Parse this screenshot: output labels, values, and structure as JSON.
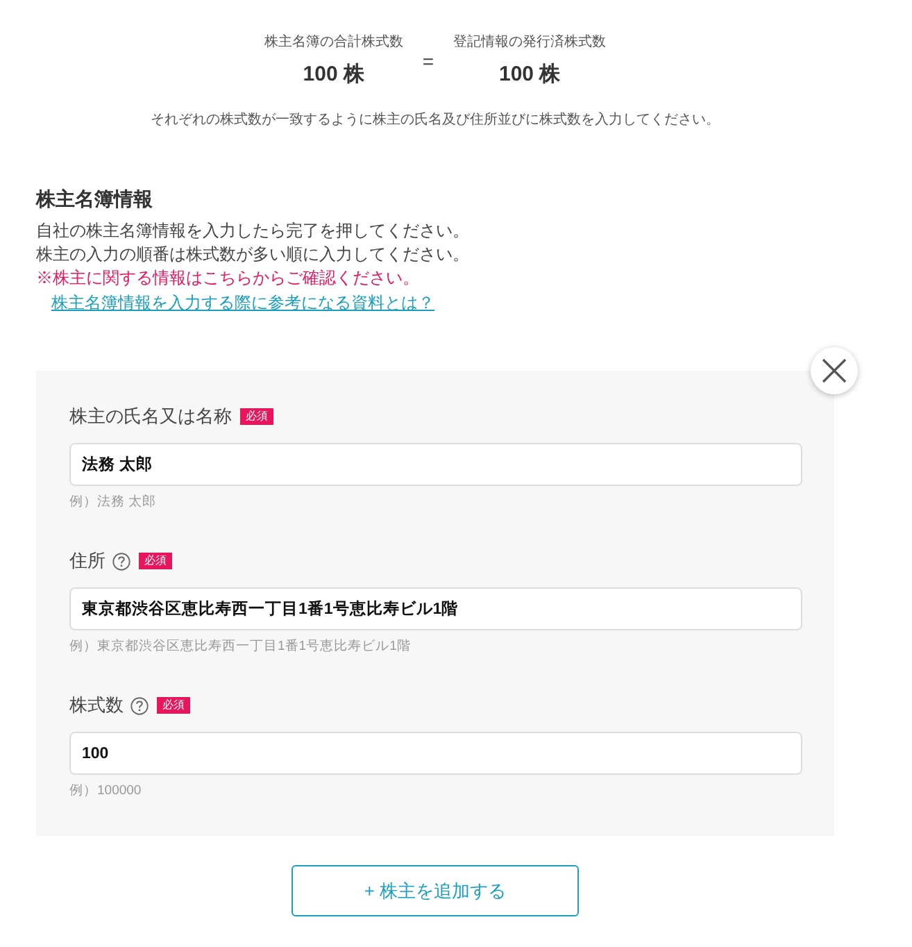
{
  "summary": {
    "left": {
      "label": "株主名簿の合計株式数",
      "value": "100 株"
    },
    "operator": "=",
    "right": {
      "label": "登記情報の発行済株式数",
      "value": "100 株"
    },
    "note": "それぞれの株式数が一致するように株主の氏名及び住所並びに株式数を入力してください。"
  },
  "section": {
    "title": "株主名簿情報",
    "lines": [
      {
        "kind": "normal",
        "text": "自社の株主名簿情報を入力したら完了を押してください。"
      },
      {
        "kind": "normal",
        "text": "株主の入力の順番は株式数が多い順に入力してください。"
      },
      {
        "kind": "warning",
        "text": "※株主に関する情報はこちらからご確認ください。"
      }
    ],
    "link": "株主名簿情報を入力する際に参考になる資料とは？"
  },
  "shareholder_form": {
    "fields": [
      {
        "label": "株主の氏名又は名称",
        "help": false,
        "badge": "必須",
        "value": "法務 太郎",
        "example": "例）法務 太郎"
      },
      {
        "label": "住所",
        "help": true,
        "badge": "必須",
        "value": "東京都渋谷区恵比寿西一丁目1番1号恵比寿ビル1階",
        "example": "例）東京都渋谷区恵比寿西一丁目1番1号恵比寿ビル1階"
      },
      {
        "label": "株式数",
        "help": true,
        "badge": "必須",
        "value": "100",
        "example": "例）100000"
      }
    ]
  },
  "add_button": "+ 株主を追加する"
}
